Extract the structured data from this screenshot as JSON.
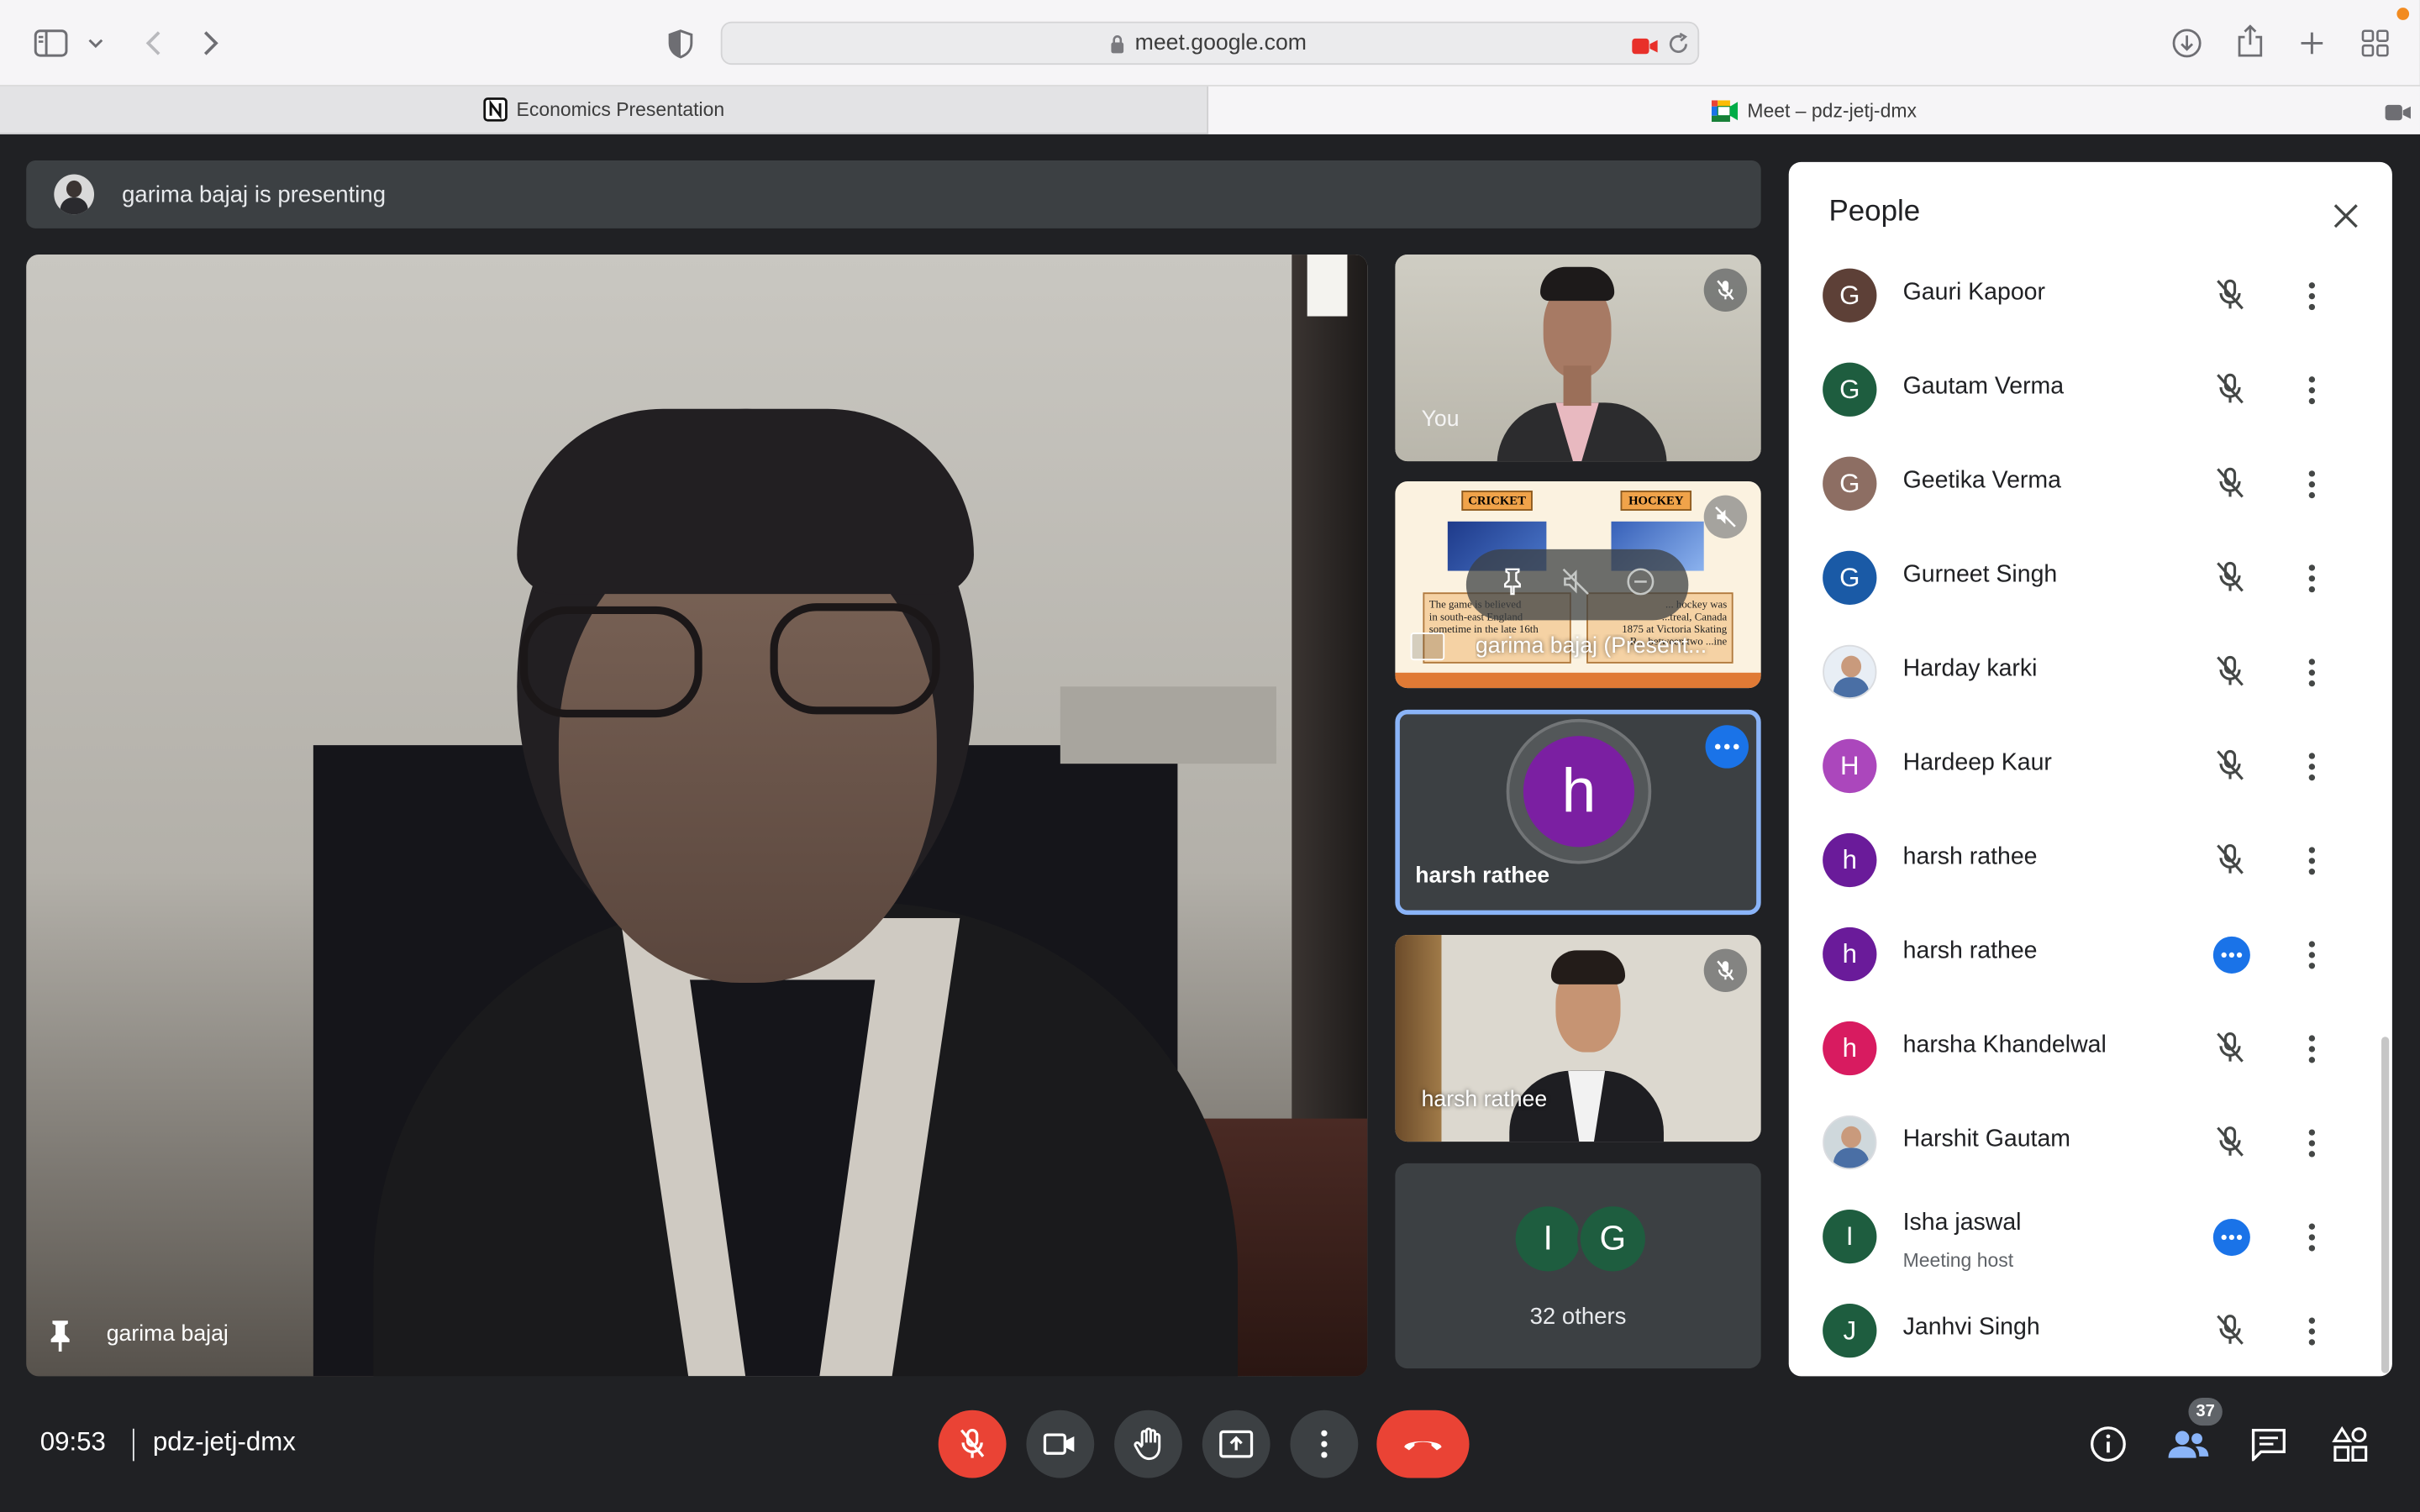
{
  "browser": {
    "url": "meet.google.com",
    "tabs": [
      {
        "label": "Economics Presentation",
        "active": false
      },
      {
        "label": "Meet – pdz-jetj-dmx",
        "active": true
      }
    ]
  },
  "presenting_banner": "garima bajaj is presenting",
  "main_video": {
    "name": "garima bajaj"
  },
  "tiles": [
    {
      "name": "You"
    },
    {
      "name": "garima bajaj (Present...",
      "slide_labels": [
        "CRICKET",
        "HOCKEY"
      ],
      "slide_text_left": [
        "The game is believed",
        "in south-east England",
        "sometime in the late 16th"
      ],
      "slide_text_right": [
        "... hockey was",
        "...treal, Canada",
        "1875 at Victoria Skating",
        "R... between two ...ine"
      ]
    },
    {
      "name": "harsh rathee",
      "initial": "h"
    },
    {
      "name": "harsh rathee"
    },
    {
      "initials": [
        "I",
        "G"
      ],
      "label": "32 others"
    }
  ],
  "people_panel": {
    "title": "People",
    "people": [
      {
        "initial": "G",
        "name": "Gauri Kapoor",
        "color": "#5d4037",
        "status": "muted"
      },
      {
        "initial": "G",
        "name": "Gautam Verma",
        "color": "#1e5d3f",
        "status": "muted"
      },
      {
        "initial": "G",
        "name": "Geetika Verma",
        "color": "#8d6e63",
        "status": "muted"
      },
      {
        "initial": "G",
        "name": "Gurneet Singh",
        "color": "#1a5aa6",
        "status": "muted"
      },
      {
        "initial": "",
        "name": "Harday karki",
        "color": "#e8eef5",
        "status": "muted"
      },
      {
        "initial": "H",
        "name": "Hardeep Kaur",
        "color": "#ab47bc",
        "status": "muted"
      },
      {
        "initial": "h",
        "name": "harsh rathee",
        "color": "#6a1b9a",
        "status": "muted"
      },
      {
        "initial": "h",
        "name": "harsh rathee",
        "color": "#6a1b9a",
        "status": "speaking"
      },
      {
        "initial": "h",
        "name": "harsha Khandelwal",
        "color": "#d81b60",
        "status": "muted"
      },
      {
        "initial": "",
        "name": "Harshit Gautam",
        "color": "#cfd8dc",
        "status": "muted"
      },
      {
        "initial": "I",
        "name": "Isha jaswal",
        "subtitle": "Meeting host",
        "color": "#1e5d3f",
        "status": "speaking"
      },
      {
        "initial": "J",
        "name": "Janhvi Singh",
        "color": "#1e5d3f",
        "status": "muted"
      }
    ]
  },
  "bottom_bar": {
    "time": "09:53",
    "meeting_code": "pdz-jetj-dmx",
    "people_count": "37"
  },
  "colors": {
    "meet_bg": "#202124",
    "leave_red": "#ea4335",
    "accent_blue": "#1a73e8"
  }
}
